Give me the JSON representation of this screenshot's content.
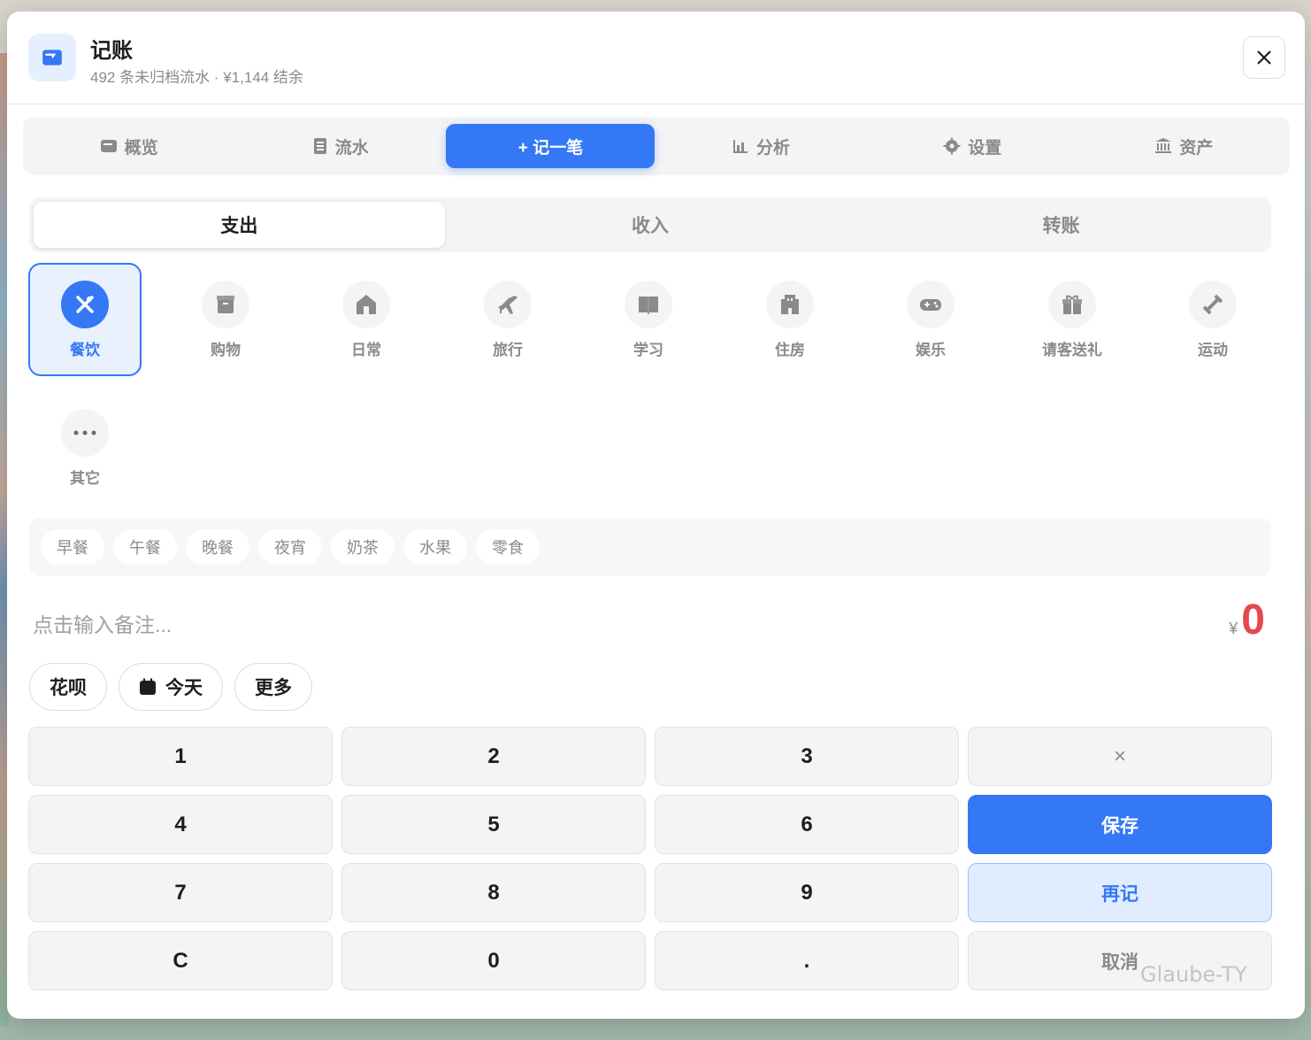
{
  "header": {
    "title": "记账",
    "subtitle": "492 条未归档流水 · ¥1,144 结余"
  },
  "nav": {
    "items": [
      {
        "label": "概览",
        "icon": "wallet-icon"
      },
      {
        "label": "流水",
        "icon": "receipt-icon"
      },
      {
        "label": "+ 记一笔",
        "icon": "plus-icon",
        "active": true
      },
      {
        "label": "分析",
        "icon": "chart-icon"
      },
      {
        "label": "设置",
        "icon": "gear-icon"
      },
      {
        "label": "资产",
        "icon": "bank-icon"
      }
    ]
  },
  "type_tabs": [
    "支出",
    "收入",
    "转账"
  ],
  "categories": [
    {
      "label": "餐饮",
      "icon": "utensils-icon",
      "active": true
    },
    {
      "label": "购物",
      "icon": "shopping-box-icon"
    },
    {
      "label": "日常",
      "icon": "house-icon"
    },
    {
      "label": "旅行",
      "icon": "plane-icon"
    },
    {
      "label": "学习",
      "icon": "book-icon"
    },
    {
      "label": "住房",
      "icon": "building-icon"
    },
    {
      "label": "娱乐",
      "icon": "gamepad-icon"
    },
    {
      "label": "请客送礼",
      "icon": "gift-icon"
    },
    {
      "label": "运动",
      "icon": "dumbbell-icon"
    },
    {
      "label": "其它",
      "icon": "more-icon"
    }
  ],
  "quick_tags": [
    "早餐",
    "午餐",
    "晚餐",
    "夜宵",
    "奶茶",
    "水果",
    "零食"
  ],
  "note": {
    "placeholder": "点击输入备注..."
  },
  "amount": {
    "currency": "¥",
    "value": "0"
  },
  "pills": {
    "account": "花呗",
    "date": "今天",
    "more": "更多"
  },
  "keypad": {
    "k1": "1",
    "k2": "2",
    "k3": "3",
    "backspace": "×",
    "k4": "4",
    "k5": "5",
    "k6": "6",
    "save": "保存",
    "k7": "7",
    "k8": "8",
    "k9": "9",
    "again": "再记",
    "clear": "C",
    "k0": "0",
    "dot": ".",
    "cancel": "取消"
  },
  "watermark": "Glaube-TY",
  "colors": {
    "accent": "#3478f6",
    "amount": "#e5484d"
  }
}
